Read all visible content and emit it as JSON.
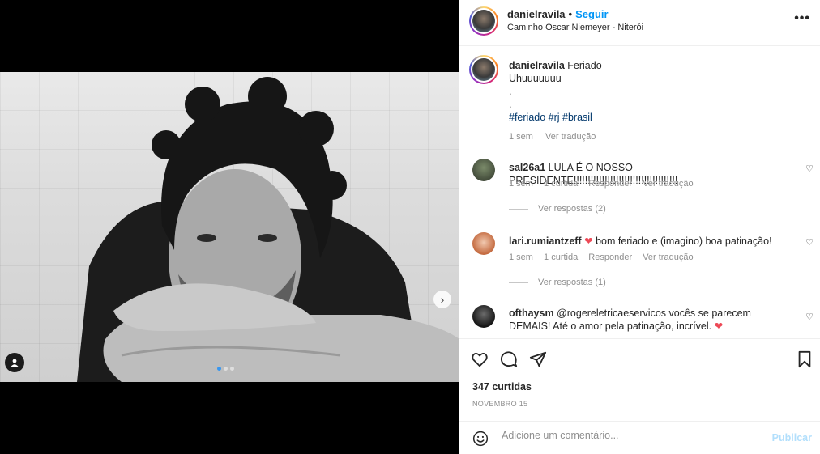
{
  "post": {
    "username": "danielravila",
    "follow_label": "Seguir",
    "location": "Caminho Oscar Niemeyer - Niterói",
    "more_label": "•••"
  },
  "caption": {
    "username": "danielravila",
    "title": "Feriado",
    "line1": "Uhuuuuuuu",
    "dot1": ".",
    "dot2": ".",
    "hashtags": "#feriado #rj #brasil",
    "time": "1 sem",
    "translate": "Ver tradução"
  },
  "comments": [
    {
      "username": "sal26a1",
      "text": "LULA É O NOSSO PRESIDENTE!!!!!!!!!!!!!!!!!!!!!!!!!!!!!!!!!!!!!",
      "time": "1 sem",
      "likes": "1 curtida",
      "reply": "Responder",
      "translate": "Ver tradução",
      "replies": "Ver respostas (2)"
    },
    {
      "username": "lari.rumiantzeff",
      "text_before": "",
      "text_after": "bom feriado e (imagino) boa patinação!",
      "time": "1 sem",
      "likes": "1 curtida",
      "reply": "Responder",
      "translate": "Ver tradução",
      "replies": "Ver respostas (1)"
    },
    {
      "username": "ofthaysm",
      "mention": "@rogereletricaeservicos",
      "text": "vocês se parecem DEMAIS! Até o amor pela patinação, incrível."
    }
  ],
  "actions": {
    "likes": "347 curtidas",
    "date": "NOVEMBRO 15"
  },
  "add_comment": {
    "placeholder": "Adicione um comentário...",
    "publish": "Publicar"
  },
  "colors": {
    "link": "#0095f6",
    "hashtag": "#00376b",
    "muted": "#8e8e8e",
    "heart": "#ed4956"
  }
}
